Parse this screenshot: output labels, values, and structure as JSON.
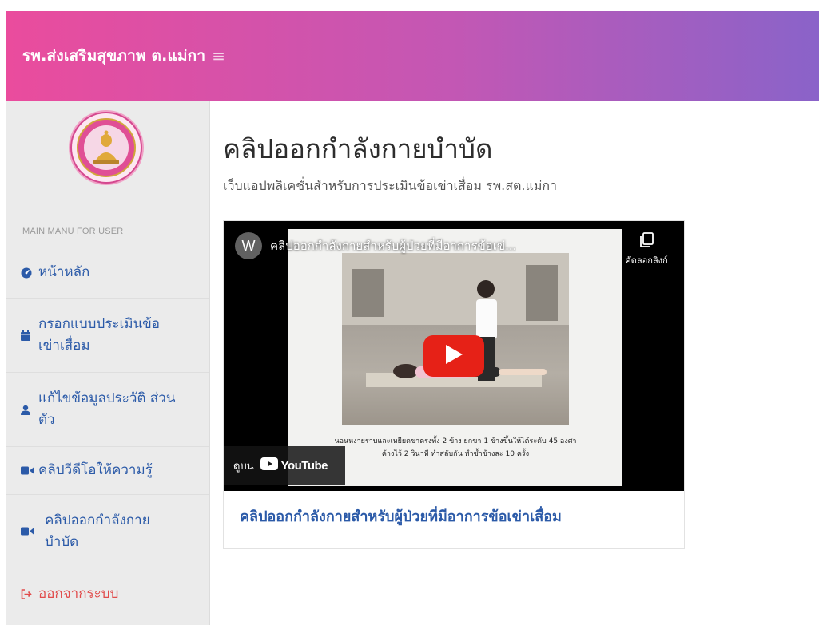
{
  "header": {
    "brand": "รพ.ส่งเสริมสุขภาพ ต.แม่กา",
    "menu_icon": "hamburger-icon"
  },
  "sidebar": {
    "logo": "hospital-seal-logo",
    "menu_header": "MAIN MANU FOR USER",
    "items": [
      {
        "label": "หน้าหลัก",
        "icon": "dashboard-icon"
      },
      {
        "label": "กรอกแบบประเมินข้อ เข่าเสื่อม",
        "icon": "calendar-icon"
      },
      {
        "label": "แก้ไขข้อมูลประวัติ ส่วนตัว",
        "icon": "user-icon"
      },
      {
        "label": "คลิปวีดีโอให้ความรู้",
        "icon": "video-camera-icon"
      },
      {
        "label": "คลิปออกกำลังกาย บำบัด",
        "icon": "video-camera-icon"
      },
      {
        "label": "ออกจากระบบ",
        "icon": "sign-out-icon"
      }
    ]
  },
  "main": {
    "title": "คลิปออกกำลังกายบำบัด",
    "subtitle": "เว็บแอปพลิเคชั่นสำหรับการประเมินข้อเข่าเสื่อม รพ.สต.แม่กา"
  },
  "video_card": {
    "channel_initial": "W",
    "video_title": "คลิปออกกำลังกายสำหรับผู้ป่วยที่มีอาการข้อเข่...",
    "copy_link_label": "คัดลอกลิงก์",
    "caption_line1": "นอนหงายราบและเหยียดขาตรงทั้ง 2 ข้าง ยกขา 1 ข้างขึ้นให้ได้ระดับ 45 องศา",
    "caption_line2": "ค้างไว้ 2 วินาที ทำสลับกัน ทำซ้ำข้างละ 10 ครั้ง",
    "watch_on_label": "ดูบน",
    "youtube_label": "YouTube",
    "card_title": "คลิปออกกำลังกายสำหรับผู้ป่วยที่มีอาการข้อเข่าเสื่อม"
  },
  "colors": {
    "header_gradient_start": "#ea4c9d",
    "header_gradient_end": "#8a63c9",
    "link_blue": "#2b5aa8",
    "logout_red": "#e14c4c",
    "youtube_red": "#e62117"
  }
}
